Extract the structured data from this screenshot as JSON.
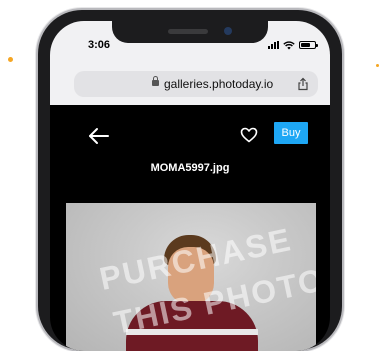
{
  "status_bar": {
    "time": "3:06"
  },
  "browser": {
    "url": "galleries.photoday.io"
  },
  "gallery": {
    "filename": "MOMA5997.jpg",
    "buy_label": "Buy"
  },
  "colors": {
    "accent": "#1ea7f5",
    "nav_background": "#000000",
    "browser_chrome": "#f1f1f3"
  },
  "photo": {
    "watermark_line1": "PURCHASE",
    "watermark_line2": "THIS PHOTO"
  }
}
